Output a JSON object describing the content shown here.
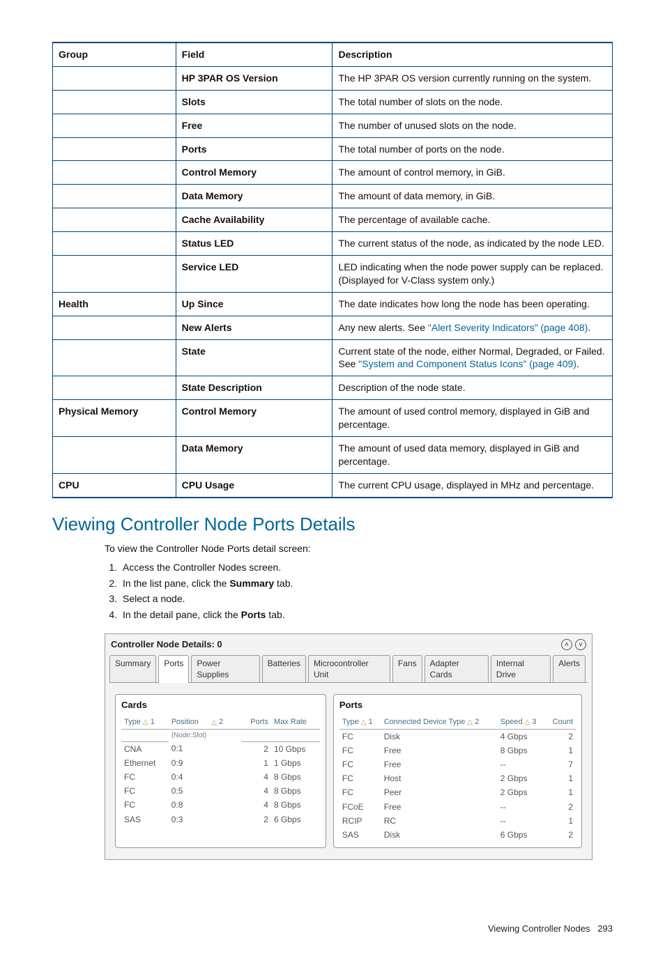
{
  "refTable": {
    "headers": {
      "group": "Group",
      "field": "Field",
      "desc": "Description"
    },
    "rows": [
      {
        "group": "",
        "field": "HP 3PAR OS Version",
        "desc": "The HP 3PAR OS version currently running on the system."
      },
      {
        "group": "",
        "field": "Slots",
        "desc": "The total number of slots on the node."
      },
      {
        "group": "",
        "field": "Free",
        "desc": "The number of unused slots on the node."
      },
      {
        "group": "",
        "field": "Ports",
        "desc": "The total number of ports on the node."
      },
      {
        "group": "",
        "field": "Control Memory",
        "desc": "The amount of control memory, in GiB."
      },
      {
        "group": "",
        "field": "Data Memory",
        "desc": "The amount of data memory, in GiB."
      },
      {
        "group": "",
        "field": "Cache Availability",
        "desc": "The percentage of available cache."
      },
      {
        "group": "",
        "field": "Status LED",
        "desc": "The current status of the node, as indicated by the node LED."
      },
      {
        "group": "",
        "field": "Service LED",
        "desc": "LED indicating when the node power supply can be replaced. (Displayed for V-Class system only.)"
      },
      {
        "group": "Health",
        "field": "Up Since",
        "desc": "The date indicates how long the node has been operating."
      },
      {
        "group": "",
        "field": "New Alerts",
        "desc": "Any new alerts. See ",
        "link": {
          "text": "\"Alert Severity Indicators\" (page 408)",
          "after": "."
        }
      },
      {
        "group": "",
        "field": "State",
        "desc": "Current state of the node, either Normal, Degraded, or Failed. See ",
        "link": {
          "text": "\"System and Component Status Icons\" (page 409)",
          "after": "."
        }
      },
      {
        "group": "",
        "field": "State Description",
        "desc": "Description of the node state."
      },
      {
        "group": "Physical Memory",
        "field": "Control Memory",
        "desc": "The amount of used control memory, displayed in GiB and percentage."
      },
      {
        "group": "",
        "field": "Data Memory",
        "desc": "The amount of used data memory, displayed in GiB and percentage."
      },
      {
        "group": "CPU",
        "field": "CPU Usage",
        "desc": "The current CPU usage, displayed in MHz and percentage."
      }
    ]
  },
  "heading": "Viewing Controller Node Ports Details",
  "intro": "To view the Controller Node Ports detail screen:",
  "steps": [
    "Access the Controller Nodes screen.",
    {
      "pre": "In the list pane, click the ",
      "bold": "Summary",
      "post": " tab."
    },
    "Select a node.",
    {
      "pre": "In the detail pane, click the ",
      "bold": "Ports",
      "post": " tab."
    }
  ],
  "shot": {
    "title": "Controller Node Details: 0",
    "tabs": [
      "Summary",
      "Ports",
      "Power Supplies",
      "Batteries",
      "Microcontroller Unit",
      "Fans",
      "Adapter Cards",
      "Internal Drive",
      "Alerts"
    ],
    "activeTab": 1,
    "cards": {
      "title": "Cards",
      "headers": {
        "type": "Type",
        "sort1": "1",
        "pos": "Position",
        "sort2": "2",
        "sub": "(Node:Slot)",
        "ports": "Ports",
        "rate": "Max Rate"
      },
      "rows": [
        {
          "type": "CNA",
          "pos": "0:1",
          "ports": "2",
          "rate": "10 Gbps"
        },
        {
          "type": "Ethernet",
          "pos": "0:9",
          "ports": "1",
          "rate": "1 Gbps"
        },
        {
          "type": "FC",
          "pos": "0:4",
          "ports": "4",
          "rate": "8 Gbps"
        },
        {
          "type": "FC",
          "pos": "0:5",
          "ports": "4",
          "rate": "8 Gbps"
        },
        {
          "type": "FC",
          "pos": "0:8",
          "ports": "4",
          "rate": "8 Gbps"
        },
        {
          "type": "SAS",
          "pos": "0:3",
          "ports": "2",
          "rate": "6 Gbps"
        }
      ]
    },
    "ports": {
      "title": "Ports",
      "headers": {
        "type": "Type",
        "sort1": "1",
        "cdt": "Connected Device Type",
        "sort2": "2",
        "speed": "Speed",
        "sort3": "3",
        "count": "Count"
      },
      "rows": [
        {
          "type": "FC",
          "cdt": "Disk",
          "speed": "4 Gbps",
          "count": "2"
        },
        {
          "type": "FC",
          "cdt": "Free",
          "speed": "8 Gbps",
          "count": "1"
        },
        {
          "type": "FC",
          "cdt": "Free",
          "speed": "--",
          "count": "7"
        },
        {
          "type": "FC",
          "cdt": "Host",
          "speed": "2 Gbps",
          "count": "1"
        },
        {
          "type": "FC",
          "cdt": "Peer",
          "speed": "2 Gbps",
          "count": "1"
        },
        {
          "type": "FCoE",
          "cdt": "Free",
          "speed": "--",
          "count": "2"
        },
        {
          "type": "RCIP",
          "cdt": "RC",
          "speed": "--",
          "count": "1"
        },
        {
          "type": "SAS",
          "cdt": "Disk",
          "speed": "6 Gbps",
          "count": "2"
        }
      ]
    },
    "icons": {
      "up": "˄",
      "down": "˅",
      "tri": "△"
    }
  },
  "footer": {
    "text": "Viewing Controller Nodes",
    "page": "293"
  }
}
